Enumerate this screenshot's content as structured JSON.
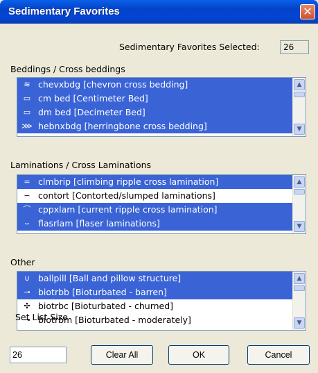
{
  "window": {
    "title": "Sedimentary Favorites",
    "close_glyph": "✕"
  },
  "selected": {
    "label": "Sedimentary Favorites Selected:",
    "count": "26"
  },
  "groups": [
    {
      "label": "Beddings / Cross beddings",
      "items": [
        {
          "icon": "chevron-bedding-icon",
          "glyph": "≋",
          "text": "chevxbdg [chevron cross bedding]",
          "selected": true
        },
        {
          "icon": "centimeter-bed-icon",
          "glyph": "▭",
          "text": "cm bed [Centimeter Bed]",
          "selected": true
        },
        {
          "icon": "decimeter-bed-icon",
          "glyph": "▭",
          "text": "dm bed [Decimeter Bed]",
          "selected": true
        },
        {
          "icon": "herringbone-bedding-icon",
          "glyph": "⋙",
          "text": "hebnxbdg [herringbone cross bedding]",
          "selected": true
        }
      ]
    },
    {
      "label": "Laminations / Cross Laminations",
      "items": [
        {
          "icon": "climbing-ripple-icon",
          "glyph": "≈",
          "text": "clmbrip [climbing ripple cross lamination]",
          "selected": true
        },
        {
          "icon": "contorted-lamination-icon",
          "glyph": "∽",
          "text": "contort [Contorted/slumped laminations]",
          "selected": false
        },
        {
          "icon": "current-ripple-icon",
          "glyph": "⌒",
          "text": "cppxlam [current ripple cross lamination]",
          "selected": true
        },
        {
          "icon": "flaser-lamination-icon",
          "glyph": "⌣",
          "text": "flasrlam [flaser laminations]",
          "selected": true
        }
      ]
    },
    {
      "label": "Other",
      "items": [
        {
          "icon": "ball-pillow-icon",
          "glyph": "∪",
          "text": "ballpill [Ball and pillow structure]",
          "selected": true
        },
        {
          "icon": "bioturbated-barren-icon",
          "glyph": "⊸",
          "text": "biotrbb [Bioturbated - barren]",
          "selected": true
        },
        {
          "icon": "bioturbated-churned-icon",
          "glyph": "✣",
          "text": "biotrbc [Bioturbated - churned]",
          "selected": false
        },
        {
          "icon": "bioturbated-moderately-icon",
          "glyph": "⊸",
          "text": "biotrbm [Bioturbated - moderately]",
          "selected": false
        }
      ]
    }
  ],
  "list_size": {
    "label": "Set List Size",
    "value": "26"
  },
  "buttons": {
    "clear_all": "Clear All",
    "ok": "OK",
    "cancel": "Cancel"
  },
  "scroll_glyphs": {
    "up": "▲",
    "down": "▼"
  },
  "colors": {
    "titlebar": "#0a5fe8",
    "selection": "#3a63d6",
    "window_bg": "#ece9d8"
  }
}
